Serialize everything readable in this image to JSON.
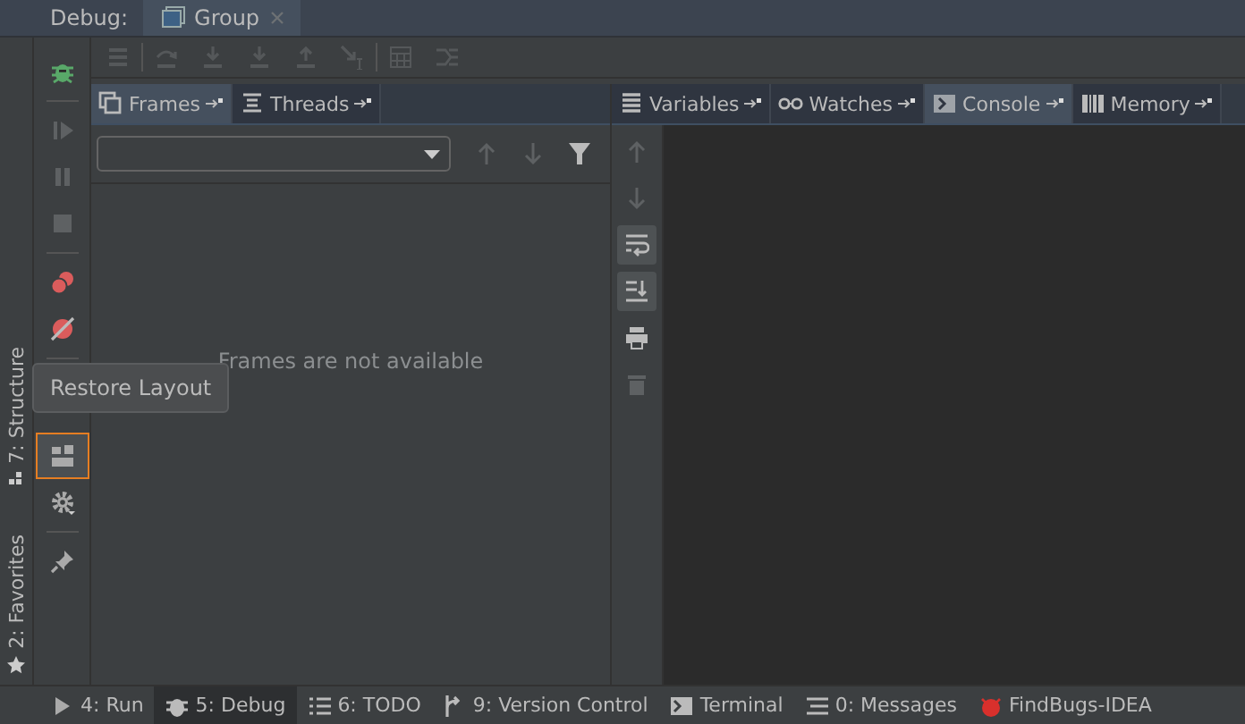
{
  "header": {
    "label": "Debug:",
    "tabs": [
      {
        "label": "Group",
        "selected": true
      }
    ]
  },
  "left_panel": {
    "tabs": [
      {
        "label": "Frames",
        "selected": true
      },
      {
        "label": "Threads",
        "selected": false
      }
    ],
    "empty_message": "Frames are not available"
  },
  "right_panel": {
    "tabs": [
      {
        "label": "Variables",
        "selected": false
      },
      {
        "label": "Watches",
        "selected": false
      },
      {
        "label": "Console",
        "selected": true
      },
      {
        "label": "Memory",
        "selected": false
      }
    ]
  },
  "tooltip": {
    "text": "Restore Layout"
  },
  "side_tool_windows": [
    {
      "label": "7: Structure"
    },
    {
      "label": "2: Favorites"
    }
  ],
  "bottom_bar": [
    {
      "label": "4: Run",
      "selected": false
    },
    {
      "label": "5: Debug",
      "selected": true
    },
    {
      "label": "6: TODO",
      "selected": false
    },
    {
      "label": "9: Version Control",
      "selected": false
    },
    {
      "label": "Terminal",
      "selected": false
    },
    {
      "label": "0: Messages",
      "selected": false
    },
    {
      "label": "FindBugs-IDEA",
      "selected": false
    }
  ]
}
